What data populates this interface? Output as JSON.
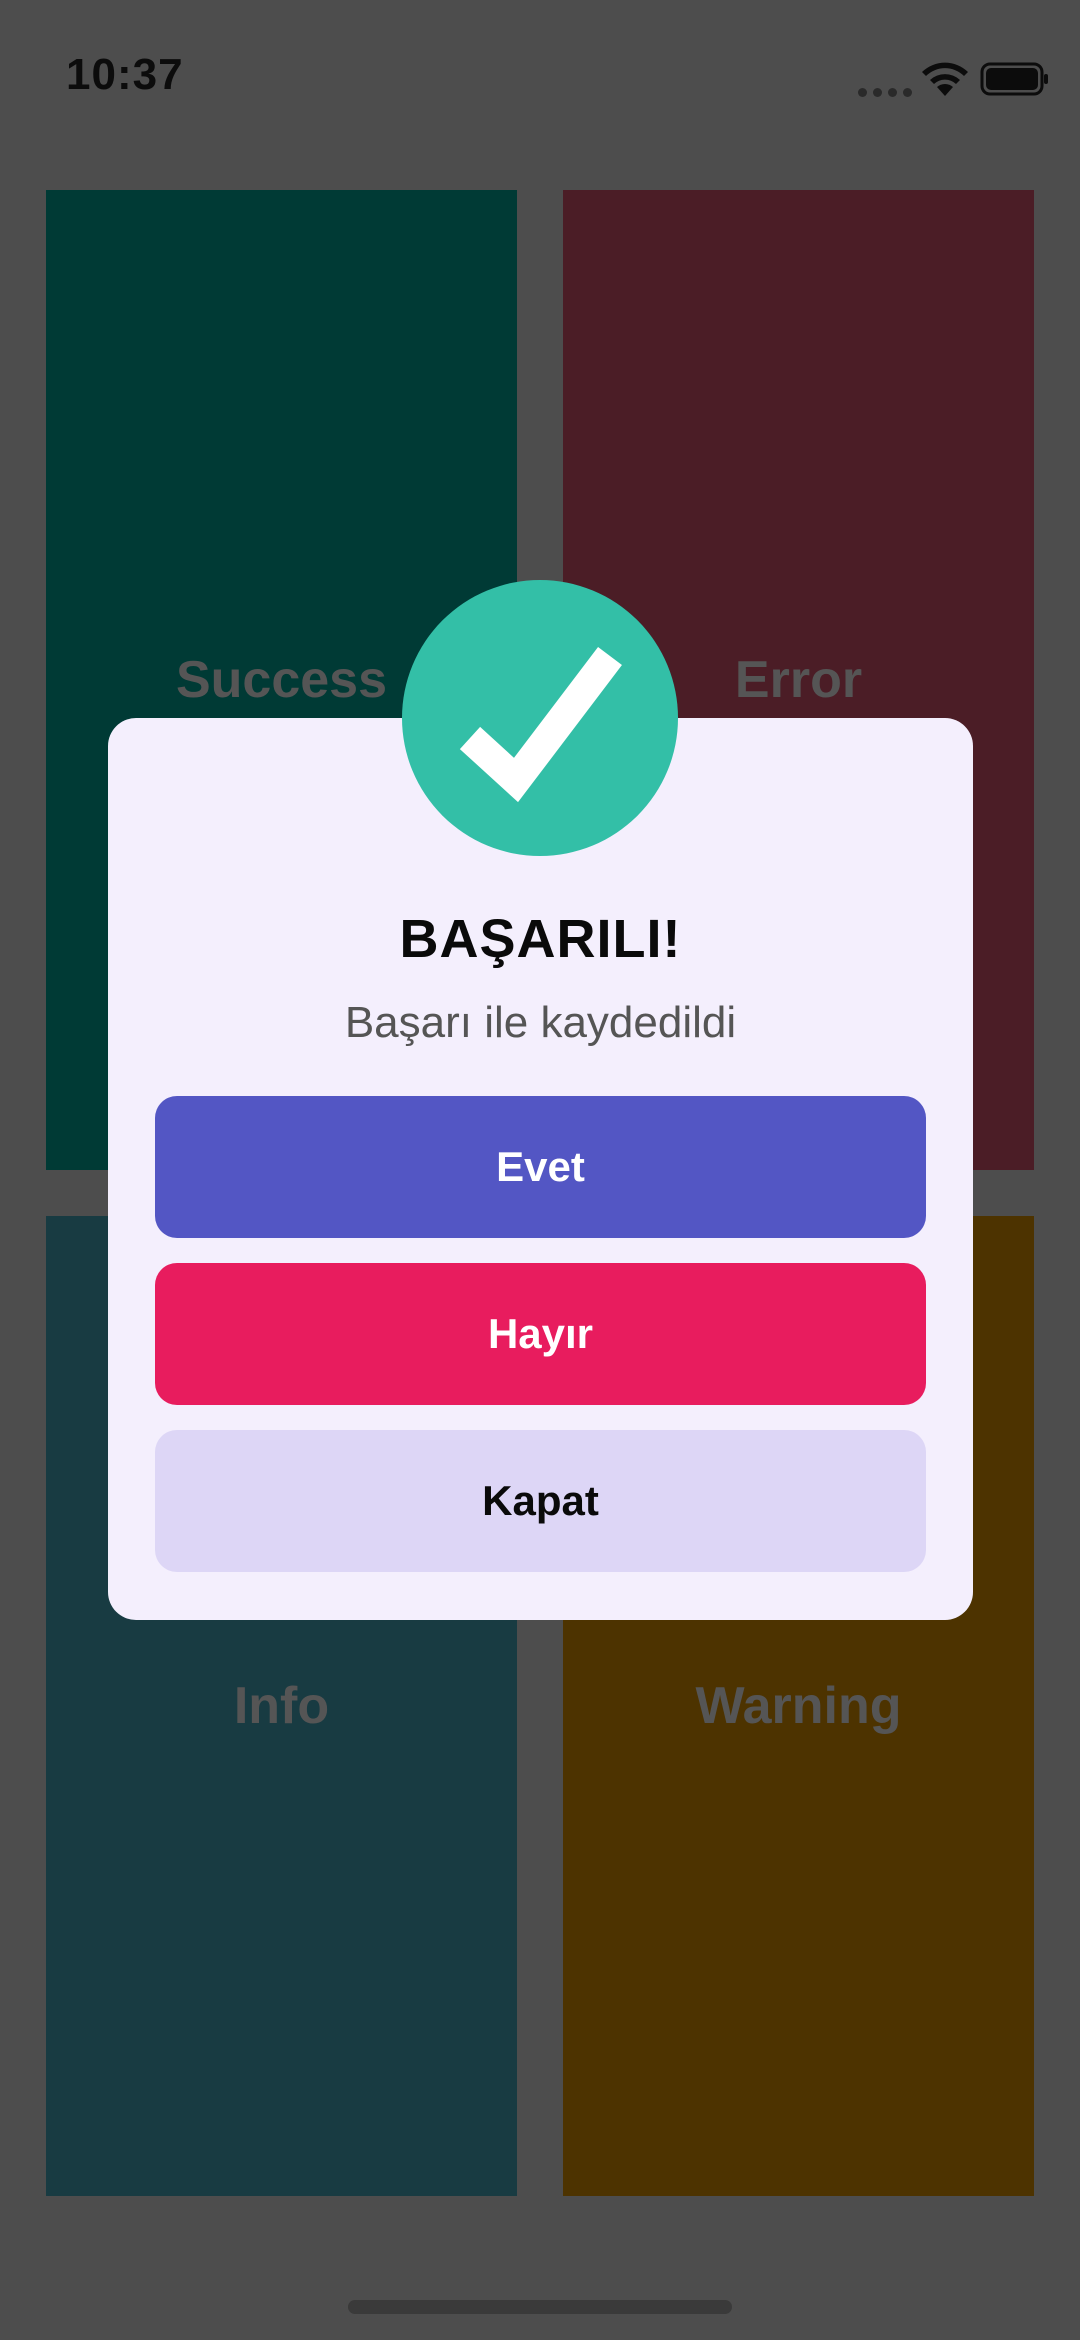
{
  "status_bar": {
    "time": "10:37",
    "icons": [
      "signal-dots-icon",
      "wifi-icon",
      "battery-icon"
    ]
  },
  "tiles": {
    "success": {
      "label": "Success",
      "color": "#003a35"
    },
    "error": {
      "label": "Error",
      "color": "#4b1d26"
    },
    "info": {
      "label": "Info",
      "color": "#183b42"
    },
    "warning": {
      "label": "Warning",
      "color": "#4d3300"
    }
  },
  "dialog": {
    "icon": "checkmark-icon",
    "badge_color": "#33bfa7",
    "title": "BAŞARILI!",
    "message": "Başarı ile kaydedildi",
    "buttons": {
      "yes": {
        "label": "Evet",
        "color": "#5356c4"
      },
      "no": {
        "label": "Hayır",
        "color": "#e81c5e"
      },
      "close": {
        "label": "Kapat",
        "color": "#ddd6f6"
      }
    }
  }
}
